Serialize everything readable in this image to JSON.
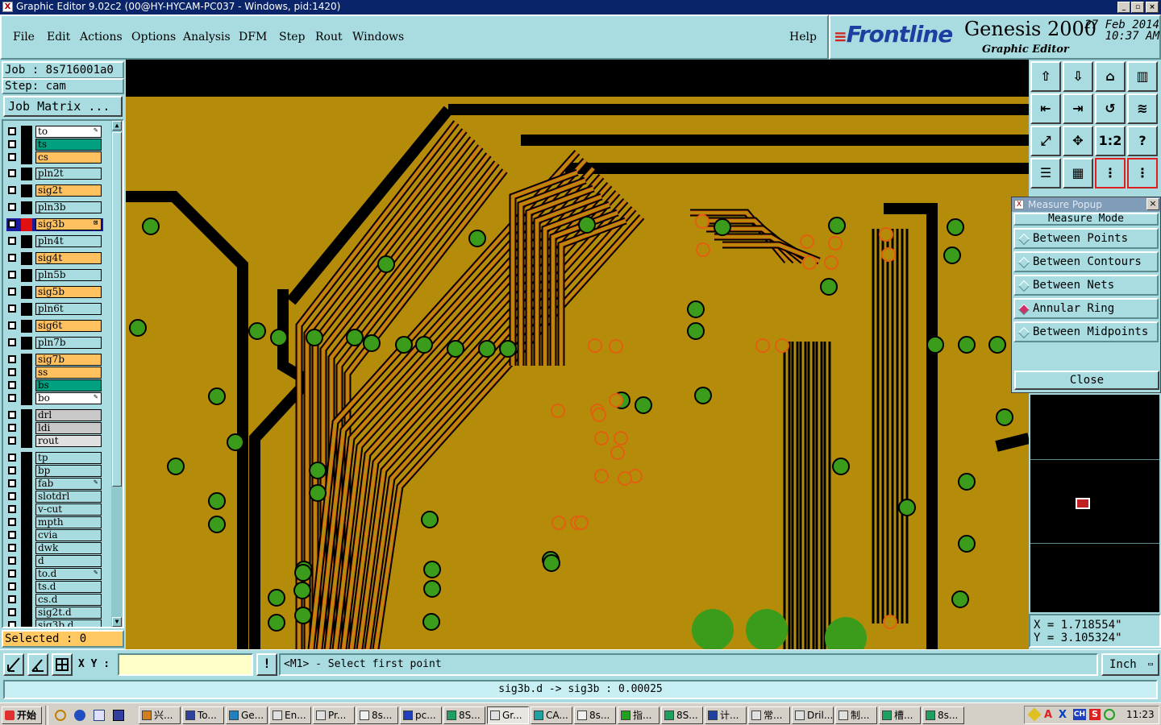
{
  "window": {
    "title": "Graphic Editor 9.02c2 (00@HY-HYCAM-PC037 - Windows, pid:1420)",
    "title_icon": "X"
  },
  "menu": [
    "File",
    "Edit",
    "Actions",
    "Options",
    "Analysis",
    "DFM",
    "Step",
    "Rout",
    "Windows"
  ],
  "help_label": "Help",
  "brand": {
    "logo": "Frontline",
    "product": "Genesis 2000",
    "subtitle": "Graphic Editor",
    "date": "27 Feb 2014",
    "time": "10:37 AM"
  },
  "job": {
    "job_label": "Job : 8s716001a0",
    "step_label": "Step: cam",
    "matrix_button": "Job Matrix ..."
  },
  "layers": [
    {
      "name": "to",
      "color": "#ffffff",
      "mark": "✎"
    },
    {
      "name": "ts",
      "color": "#00a080"
    },
    {
      "name": "cs",
      "color": "#ffc060"
    },
    {
      "name": "pln2t",
      "color": "#a8dce0"
    },
    {
      "name": "sig2t",
      "color": "#ffc060"
    },
    {
      "name": "pln3b",
      "color": "#a8dce0"
    },
    {
      "name": "sig3b",
      "color": "#ffc060",
      "active": true,
      "mark": "⊠"
    },
    {
      "name": "pln4t",
      "color": "#a8dce0"
    },
    {
      "name": "sig4t",
      "color": "#ffc060"
    },
    {
      "name": "pln5b",
      "color": "#a8dce0"
    },
    {
      "name": "sig5b",
      "color": "#ffc060"
    },
    {
      "name": "pln6t",
      "color": "#a8dce0"
    },
    {
      "name": "sig6t",
      "color": "#ffc060"
    },
    {
      "name": "pln7b",
      "color": "#a8dce0"
    },
    {
      "name": "sig7b",
      "color": "#ffc060"
    },
    {
      "name": "ss",
      "color": "#ffc060"
    },
    {
      "name": "bs",
      "color": "#00a080"
    },
    {
      "name": "bo",
      "color": "#ffffff",
      "mark": "✎"
    },
    {
      "name": "drl",
      "color": "#c8c8c8"
    },
    {
      "name": "ldi",
      "color": "#c8c8c8"
    },
    {
      "name": "rout",
      "color": "#e0e0e0"
    },
    {
      "name": "tp",
      "color": "#a8dce0"
    },
    {
      "name": "bp",
      "color": "#a8dce0"
    },
    {
      "name": "fab",
      "color": "#a8dce0",
      "mark": "✎"
    },
    {
      "name": "slotdrl",
      "color": "#a8dce0"
    },
    {
      "name": "v-cut",
      "color": "#a8dce0"
    },
    {
      "name": "mpth",
      "color": "#a8dce0"
    },
    {
      "name": "cvia",
      "color": "#a8dce0"
    },
    {
      "name": "dwk",
      "color": "#a8dce0"
    },
    {
      "name": "d",
      "color": "#a8dce0"
    },
    {
      "name": "to.d",
      "color": "#a8dce0",
      "mark": "✎"
    },
    {
      "name": "ts.d",
      "color": "#a8dce0"
    },
    {
      "name": "cs.d",
      "color": "#a8dce0"
    },
    {
      "name": "sig2t.d",
      "color": "#a8dce0"
    },
    {
      "name": "sig3b.d",
      "color": "#a8dce0"
    }
  ],
  "selected_label": "Selected : 0",
  "measure": {
    "title": "Measure Popup",
    "heading": "Measure Mode",
    "options": [
      "Between Points",
      "Between Contours",
      "Between Nets",
      "Annular Ring",
      "Between Midpoints"
    ],
    "selected": "Annular Ring",
    "close_label": "Close"
  },
  "coords": {
    "x": "X = 1.718554\"",
    "y": "Y = 3.105324\""
  },
  "command": {
    "xy_label": "X Y :",
    "xy_value": "",
    "prompt": "<M1> - Select first point",
    "units": "Inch",
    "exclaim": "!"
  },
  "status": "sig3b.d -> sig3b : 0.00025",
  "taskbar": {
    "start": "开始",
    "items": [
      "兴...",
      "To...",
      "Ge...",
      "En...",
      "Pr...",
      "8s...",
      "pc...",
      "8S...",
      "Gr...",
      "CA...",
      "8s...",
      "指...",
      "8S...",
      "计...",
      "常...",
      "Dril...",
      "制...",
      "槽...",
      "8s..."
    ],
    "active_index": 8,
    "clock": "11:23"
  },
  "colors": {
    "panel": "#a8dce0",
    "copper": "#b58c0a",
    "pad": "#3a9c1a",
    "trace_outline": "#e06010",
    "titlebar": "#0a246a"
  }
}
